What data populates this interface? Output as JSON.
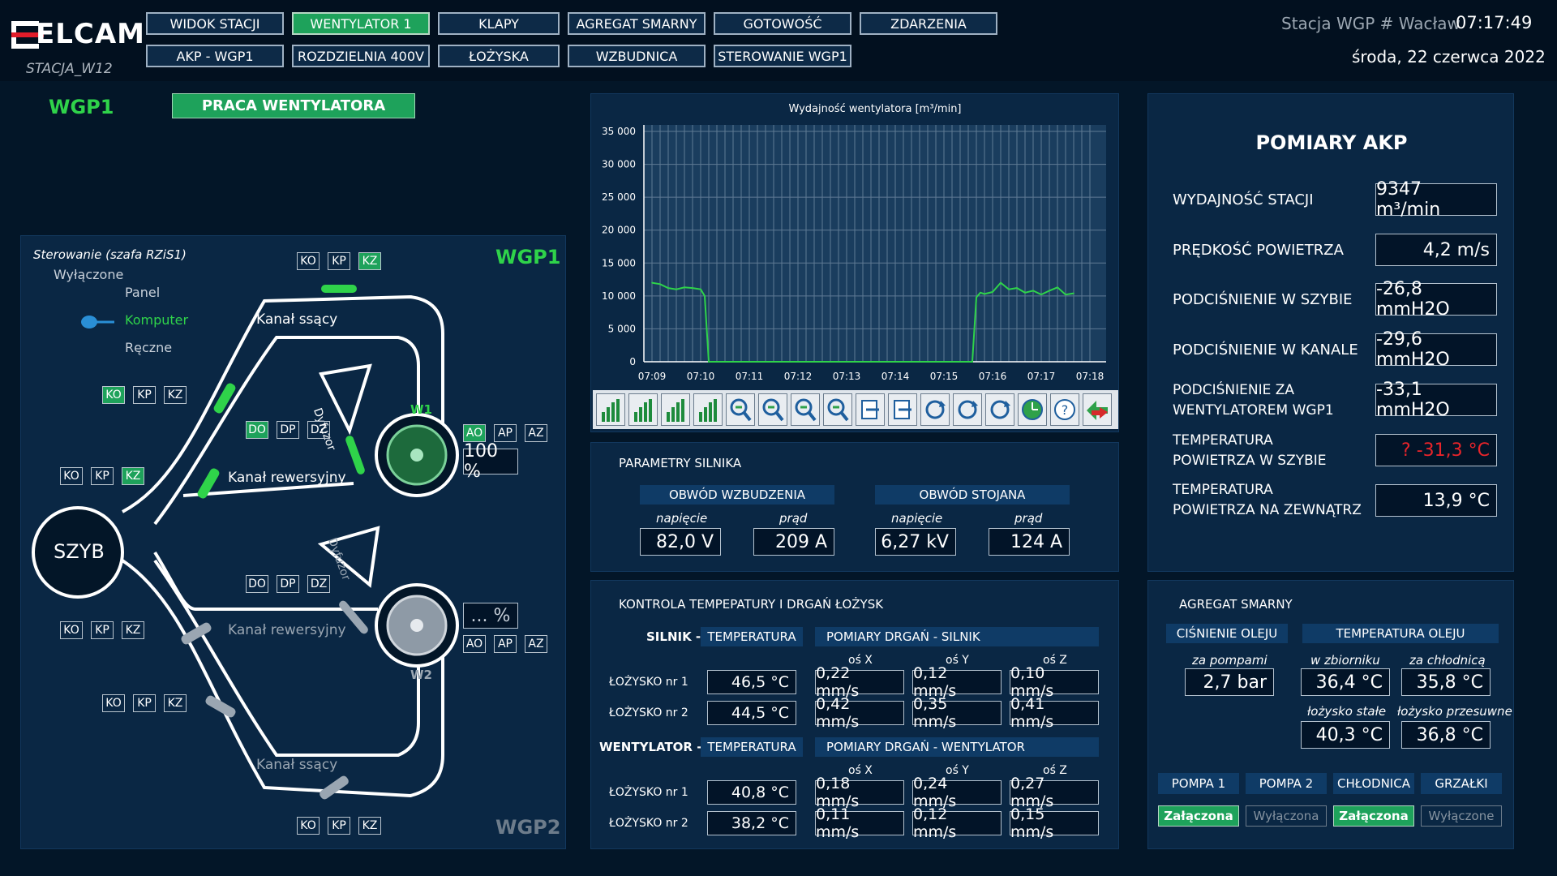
{
  "header": {
    "logo": "ELCAM",
    "station_code": "STACJA_W12",
    "station_name": "Stacja WGP # Wacław",
    "time": "07:17:49",
    "date": "środa, 22 czerwca 2022",
    "nav_row1": [
      "WIDOK STACJI",
      "WENTYLATOR 1",
      "KLAPY",
      "AGREGAT SMARNY",
      "GOTOWOŚĆ",
      "ZDARZENIA"
    ],
    "nav_row2": [
      "AKP - WGP1",
      "ROZDZIELNIA 400V",
      "ŁOŻYSKA",
      "WZBUDNICA",
      "STEROWANIE WGP1"
    ],
    "active_tab": "WENTYLATOR 1"
  },
  "top": {
    "title": "WGP1",
    "status": "PRACA WENTYLATORA",
    "status_color": "#1ea25b"
  },
  "diagram": {
    "control_title": "Sterowanie (szafa RZiS1)",
    "control_state": "Wyłączone",
    "options": [
      "Panel",
      "Komputer",
      "Ręczne"
    ],
    "selected_option": "Komputer",
    "wgp1_label": "WGP1",
    "wgp2_label": "WGP2",
    "szyb": "SZYB",
    "kanal_ssacy": "Kanał ssący",
    "kanal_rewersyjny": "Kanał rewersyjny",
    "dyfuzor": "Dyfuzor",
    "w1": "W1",
    "w2": "W2",
    "w1_percent": "100 %",
    "w2_percent": "... %",
    "btn_ko": "KO",
    "btn_kp": "KP",
    "btn_kz": "KZ",
    "btn_do": "DO",
    "btn_dp": "DP",
    "btn_dz": "DZ",
    "btn_ao": "AO",
    "btn_ap": "AP",
    "btn_az": "AZ"
  },
  "chart_data": {
    "type": "line",
    "title": "Wydajność wentylatora [m³/min]",
    "x_ticks": [
      "07:09",
      "07:10",
      "07:11",
      "07:12",
      "07:13",
      "07:14",
      "07:15",
      "07:16",
      "07:17",
      "07:18"
    ],
    "y_ticks": [
      "0",
      "5 000",
      "10 000",
      "15 000",
      "20 000",
      "25 000",
      "30 000",
      "35 000"
    ],
    "ylim": [
      0,
      35000
    ],
    "grid": true,
    "series": [
      {
        "color": "#2fd34a",
        "x": [
          "07:09:00",
          "07:09:10",
          "07:09:20",
          "07:09:30",
          "07:09:40",
          "07:09:50",
          "07:10:00",
          "07:10:05",
          "07:10:10",
          "07:11:00",
          "07:12:00",
          "07:13:00",
          "07:14:00",
          "07:15:00",
          "07:15:35",
          "07:15:40",
          "07:15:45",
          "07:15:50",
          "07:16:00",
          "07:16:10",
          "07:16:20",
          "07:16:30",
          "07:16:40",
          "07:16:50",
          "07:17:00",
          "07:17:10",
          "07:17:20",
          "07:17:30",
          "07:17:40"
        ],
        "values": [
          12000,
          11800,
          11200,
          11000,
          11300,
          11200,
          11000,
          10000,
          0,
          0,
          0,
          0,
          0,
          0,
          0,
          9800,
          10500,
          10300,
          10600,
          12000,
          11000,
          11200,
          10500,
          10800,
          10200,
          10800,
          11300,
          10200,
          10400
        ]
      }
    ]
  },
  "toolbar": {
    "buttons": [
      "bar-chart-icon",
      "bar-chart-left-icon",
      "bar-chart-down-icon",
      "bar-chart-up-icon",
      "zoom-in-icon",
      "zoom-out-icon",
      "zoom-in-alt-icon",
      "zoom-out-alt-icon",
      "export-icon",
      "import-icon",
      "refresh-icon",
      "refresh-alt-icon",
      "refresh-cycle-icon",
      "clock-icon",
      "help-icon",
      "swap-icon"
    ]
  },
  "motor": {
    "title": "PARAMETRY SILNIKA",
    "excitation": "OBWÓD WZBUDZENIA",
    "stator": "OBWÓD STOJANA",
    "voltage_label": "napięcie",
    "current_label": "prąd",
    "exc_voltage": "82,0 V",
    "exc_current": "209 A",
    "stator_voltage": "6,27 kV",
    "stator_current": "124 A"
  },
  "bearings": {
    "title": "KONTROLA TEMPEPATURY I DRGAŃ ŁOŻYSK",
    "silnik_label": "SILNIK -",
    "wentylator_label": "WENTYLATOR -",
    "temp_header": "TEMPERATURA",
    "vib_silnik_header": "POMIARY DRGAŃ - SILNIK",
    "vib_went_header": "POMIARY DRGAŃ - WENTYLATOR",
    "axes": [
      "oś X",
      "oś Y",
      "oś Z"
    ],
    "row1": "ŁOŻYSKO nr 1",
    "row2": "ŁOŻYSKO nr 2",
    "silnik": [
      {
        "temp": "46,5 °C",
        "x": "0,22 mm/s",
        "y": "0,12 mm/s",
        "z": "0,10 mm/s"
      },
      {
        "temp": "44,5 °C",
        "x": "0,42 mm/s",
        "y": "0,35 mm/s",
        "z": "0,41 mm/s"
      }
    ],
    "wentylator": [
      {
        "temp": "40,8 °C",
        "x": "0,18 mm/s",
        "y": "0,24 mm/s",
        "z": "0,27 mm/s"
      },
      {
        "temp": "38,2 °C",
        "x": "0,11 mm/s",
        "y": "0,12 mm/s",
        "z": "0,15 mm/s"
      }
    ]
  },
  "akp": {
    "title": "POMIARY AKP",
    "rows": [
      {
        "label": "WYDAJNOŚĆ STACJI",
        "value": "9347 m³/min"
      },
      {
        "label": "PRĘDKOŚĆ POWIETRZA",
        "value": "4,2 m/s"
      },
      {
        "label": "PODCIŚNIENIE W SZYBIE",
        "value": "-26,8 mmH2O"
      },
      {
        "label": "PODCIŚNIENIE W KANALE",
        "value": "-29,6 mmH2O"
      },
      {
        "label1": "PODCIŚNIENIE ZA",
        "label2": "WENTYLATOREM WGP1",
        "value": "-33,1 mmH2O"
      },
      {
        "label1": "TEMPERATURA",
        "label2": "POWIETRZA W SZYBIE",
        "value": "? -31,3 °C",
        "alarm": true
      },
      {
        "label1": "TEMPERATURA",
        "label2": "POWIETRZA NA ZEWNĄTRZ",
        "value": "13,9 °C"
      }
    ],
    "alarm_color": "#e8242a"
  },
  "lube": {
    "title": "AGREGAT SMARNY",
    "pressure_header": "CIŚNIENIE OLEJU",
    "temp_header": "TEMPERATURA OLEJU",
    "za_pompami": "za pompami",
    "w_zbiorniku": "w zbiorniku",
    "za_chlodnica": "za chłodnicą",
    "lozysko_stale": "łożysko stałe",
    "lozysko_przesuwne": "łożysko przesuwne",
    "pressure": "2,7 bar",
    "tank": "36,4 °C",
    "cooler": "35,8 °C",
    "fixed": "40,3 °C",
    "sliding": "36,8 °C",
    "devices": [
      "POMPA 1",
      "POMPA 2",
      "CHŁODNICA",
      "GRZAŁKI"
    ],
    "states": [
      "Załączona",
      "Wyłączona",
      "Załączona",
      "Wyłączone"
    ],
    "states_on": [
      true,
      false,
      true,
      false
    ]
  }
}
